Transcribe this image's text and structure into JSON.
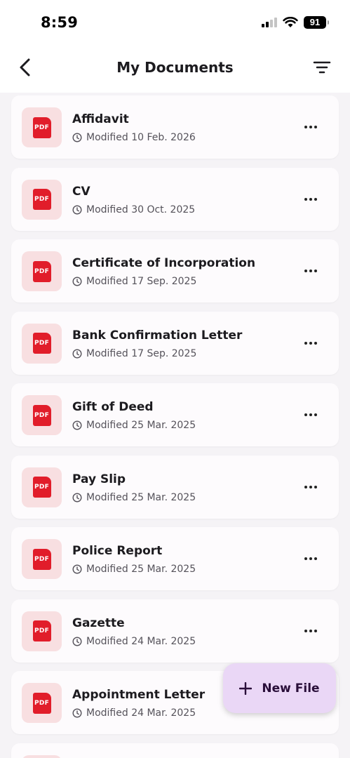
{
  "status_bar": {
    "time": "8:59",
    "battery": "91"
  },
  "header": {
    "title": "My Documents",
    "back_icon": "chevron-left-icon",
    "filter_icon": "filter-icon"
  },
  "documents": [
    {
      "name": "Affidavit",
      "modified": "Modified 10 Feb. 2026"
    },
    {
      "name": "CV",
      "modified": "Modified 30 Oct. 2025"
    },
    {
      "name": "Certificate of Incorporation",
      "modified": "Modified 17 Sep. 2025"
    },
    {
      "name": "Bank Confirmation Letter",
      "modified": "Modified 17 Sep. 2025"
    },
    {
      "name": "Gift of Deed",
      "modified": "Modified 25 Mar. 2025"
    },
    {
      "name": "Pay Slip",
      "modified": "Modified 25 Mar. 2025"
    },
    {
      "name": "Police Report",
      "modified": "Modified 25 Mar. 2025"
    },
    {
      "name": "Gazette",
      "modified": "Modified 24 Mar. 2025"
    },
    {
      "name": "Appointment Letter",
      "modified": "Modified 24 Mar. 2025"
    }
  ],
  "file_badge": "PDF",
  "fab": {
    "label": "New File",
    "icon": "plus-icon"
  },
  "colors": {
    "accent_fab": "#ead7f6",
    "pdf_red": "#e11d2a",
    "pdf_bg": "#f8dfe1"
  }
}
